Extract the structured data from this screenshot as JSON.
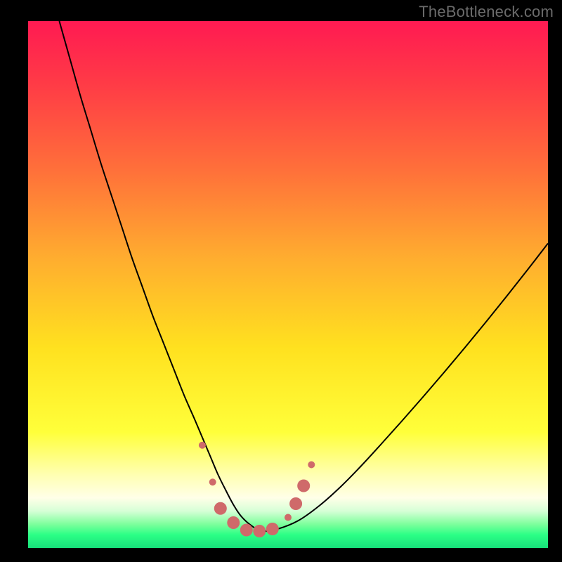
{
  "watermark": "TheBottleneck.com",
  "chart_data": {
    "type": "line",
    "title": "",
    "xlabel": "",
    "ylabel": "",
    "xlim": [
      0,
      100
    ],
    "ylim": [
      0,
      100
    ],
    "grid": false,
    "legend": false,
    "background_gradient_stops": [
      {
        "offset": 0.0,
        "color": "#ff1a52"
      },
      {
        "offset": 0.12,
        "color": "#ff3b46"
      },
      {
        "offset": 0.28,
        "color": "#ff6f3a"
      },
      {
        "offset": 0.45,
        "color": "#ffad2f"
      },
      {
        "offset": 0.62,
        "color": "#ffe11f"
      },
      {
        "offset": 0.78,
        "color": "#ffff3a"
      },
      {
        "offset": 0.86,
        "color": "#ffffb0"
      },
      {
        "offset": 0.905,
        "color": "#ffffe8"
      },
      {
        "offset": 0.93,
        "color": "#d6ffd6"
      },
      {
        "offset": 0.955,
        "color": "#7dff9c"
      },
      {
        "offset": 0.975,
        "color": "#2cff86"
      },
      {
        "offset": 1.0,
        "color": "#17e07a"
      }
    ],
    "series": [
      {
        "name": "bottleneck-curve",
        "color": "#000000",
        "width": 2,
        "x": [
          6,
          8,
          10,
          12,
          14,
          16,
          18,
          20,
          22,
          24,
          26,
          28,
          30,
          32,
          33.5,
          35,
          36.5,
          38,
          39.5,
          41,
          43,
          45,
          48,
          52,
          56,
          60,
          64,
          68,
          72,
          76,
          80,
          84,
          88,
          92,
          96,
          100
        ],
        "y": [
          100,
          93,
          86,
          79.5,
          73,
          67,
          61,
          55,
          49.5,
          44,
          39,
          34,
          29,
          24.5,
          21,
          17.5,
          14,
          11,
          8.2,
          6,
          4.2,
          3.2,
          3.6,
          5.2,
          8,
          11.5,
          15.5,
          19.8,
          24.2,
          28.7,
          33.3,
          38,
          42.8,
          47.7,
          52.7,
          57.8
        ]
      }
    ],
    "markers": {
      "name": "highlight-dots",
      "color": "#cf6a6a",
      "radius_small": 5,
      "radius_large": 9,
      "points": [
        {
          "x": 33.5,
          "y": 19.5,
          "r": "small"
        },
        {
          "x": 35.5,
          "y": 12.5,
          "r": "small"
        },
        {
          "x": 37.0,
          "y": 7.5,
          "r": "large"
        },
        {
          "x": 39.5,
          "y": 4.8,
          "r": "large"
        },
        {
          "x": 42.0,
          "y": 3.4,
          "r": "large"
        },
        {
          "x": 44.5,
          "y": 3.2,
          "r": "large"
        },
        {
          "x": 47.0,
          "y": 3.6,
          "r": "large"
        },
        {
          "x": 50.0,
          "y": 5.8,
          "r": "small"
        },
        {
          "x": 51.5,
          "y": 8.4,
          "r": "large"
        },
        {
          "x": 53.0,
          "y": 11.8,
          "r": "large"
        },
        {
          "x": 54.5,
          "y": 15.8,
          "r": "small"
        }
      ]
    }
  }
}
